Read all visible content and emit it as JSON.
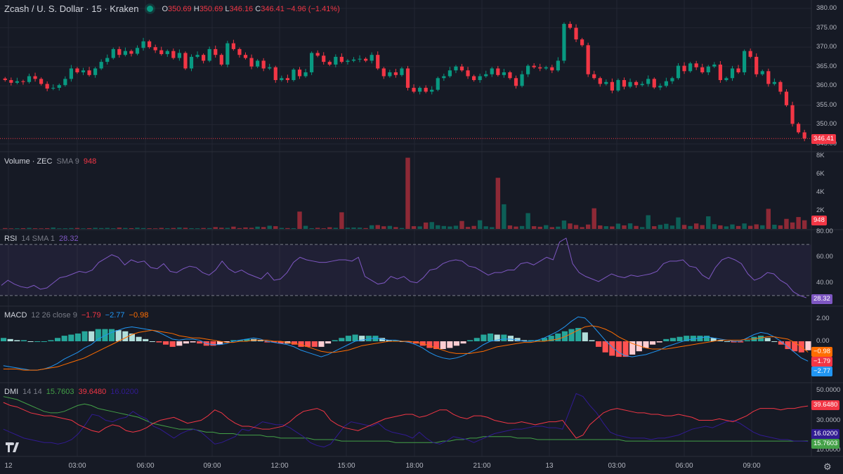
{
  "header": {
    "symbol": "Zcash / U. S. Dollar · 15 · Kraken",
    "open_label": "O",
    "open": "350.69",
    "high_label": "H",
    "high": "350.69",
    "low_label": "L",
    "low": "346.16",
    "close_label": "C",
    "close": "346.41",
    "change": "−4.96 (−1.41%)"
  },
  "volume_legend": {
    "title": "Volume · ZEC",
    "params": "SMA 9",
    "value": "948"
  },
  "rsi_legend": {
    "title": "RSI",
    "params": "14 SMA 1",
    "value": "28.32"
  },
  "macd_legend": {
    "title": "MACD",
    "params": "12 26 close 9",
    "v1": "−1.79",
    "v2": "−2.77",
    "v3": "−0.98"
  },
  "dmi_legend": {
    "title": "DMI",
    "params": "14 14",
    "v1": "15.7603",
    "v2": "39.6480",
    "v3": "16.0200"
  },
  "price_axis": [
    "380.00",
    "375.00",
    "370.00",
    "365.00",
    "360.00",
    "355.00",
    "350.00",
    "345.00"
  ],
  "volume_axis": [
    "8K",
    "6K",
    "4K",
    "2K"
  ],
  "rsi_axis": [
    "80.00",
    "60.00",
    "40.00"
  ],
  "macd_axis": [
    "2.00",
    "0.00"
  ],
  "dmi_axis": [
    "50.0000",
    "30.0000",
    "10.0000"
  ],
  "time_axis": [
    "12",
    "03:00",
    "06:00",
    "09:00",
    "12:00",
    "15:00",
    "18:00",
    "21:00",
    "13",
    "03:00",
    "06:00",
    "09:00"
  ],
  "badges": {
    "price": "346.41",
    "volume": "948",
    "rsi": "28.32",
    "macd_signal": "−0.98",
    "macd_line": "−1.79",
    "macd_hist": "−2.77",
    "dmi_adx": "39.6480",
    "dmi_plus": "16.0200",
    "dmi_minus": "15.7603"
  },
  "colors": {
    "up": "#089981",
    "down": "#f23645",
    "rsi": "#7e57c2",
    "macd": "#2962ff",
    "signal": "#ff6d00",
    "dmi_adx": "#f23645",
    "dmi_plus": "#43a047",
    "dmi_minus": "#311b92",
    "background": "#161a25"
  },
  "chart_data": [
    {
      "type": "candlestick",
      "title": "Zcash / U. S. Dollar · 15 · Kraken",
      "ylim": [
        345,
        380
      ],
      "close": [
        361.5,
        360.8,
        361.2,
        361.0,
        362.5,
        361.8,
        360.5,
        359.3,
        359.5,
        360.2,
        361.8,
        364.5,
        363.5,
        364.0,
        362.8,
        364.5,
        366.2,
        367.2,
        369.5,
        368.0,
        369.0,
        368.3,
        369.8,
        371.5,
        370.0,
        369.2,
        368.2,
        369.0,
        367.2,
        368.5,
        364.5,
        367.5,
        368.0,
        366.5,
        369.5,
        368.0,
        365.5,
        371.0,
        369.5,
        368.0,
        367.2,
        365.0,
        366.5,
        364.5,
        364.8,
        361.5,
        362.0,
        361.5,
        364.2,
        362.5,
        363.5,
        368.5,
        367.8,
        366.2,
        365.5,
        367.5,
        366.2,
        366.5,
        366.8,
        367.0,
        366.5,
        368.0,
        364.5,
        362.5,
        363.5,
        362.8,
        364.5,
        359.5,
        358.5,
        359.5,
        358.5,
        359.0,
        362.0,
        362.5,
        364.0,
        365.0,
        364.0,
        362.5,
        361.5,
        362.5,
        363.0,
        364.5,
        362.8,
        363.5,
        362.0,
        360.0,
        363.0,
        365.2,
        364.8,
        364.5,
        364.8,
        364.0,
        366.5,
        376.0,
        375.0,
        372.0,
        370.5,
        363.0,
        362.0,
        360.5,
        361.0,
        358.8,
        361.5,
        359.8,
        361.0,
        360.2,
        360.5,
        361.8,
        359.6,
        360.0,
        361.2,
        362.0,
        365.2,
        363.8,
        365.8,
        364.8,
        363.5,
        365.0,
        365.5,
        361.5,
        362.0,
        364.5,
        363.5,
        369.0,
        367.5,
        363.0,
        363.8,
        360.5,
        361.0,
        358.5,
        355.0,
        350.2,
        348.0,
        346.41
      ],
      "volume": [
        90,
        60,
        70,
        80,
        110,
        70,
        60,
        80,
        150,
        60,
        70,
        90,
        100,
        60,
        80,
        120,
        90,
        110,
        70,
        140,
        100,
        80,
        130,
        90,
        70,
        60,
        110,
        80,
        100,
        150,
        120,
        80,
        70,
        100,
        90,
        200,
        130,
        110,
        250,
        90,
        160,
        120,
        250,
        200,
        350,
        300,
        110,
        90,
        80,
        1900,
        340,
        80,
        120,
        70,
        180,
        120,
        1820,
        130,
        150,
        140,
        90,
        400,
        420,
        290,
        330,
        200,
        100,
        7800,
        300,
        280,
        700,
        750,
        400,
        320,
        270,
        350,
        870,
        220,
        330,
        950,
        290,
        190,
        5600,
        2700,
        380,
        260,
        320,
        1730,
        300,
        240,
        410,
        190,
        250,
        920,
        600,
        430,
        200,
        480,
        2260,
        380,
        300,
        270,
        580,
        390,
        610,
        330,
        200,
        1500,
        300,
        450,
        560,
        370,
        1260,
        440,
        320,
        600,
        420,
        1380,
        520,
        390,
        280,
        490,
        320,
        600,
        340,
        500,
        400,
        2200,
        460,
        390,
        1100,
        710,
        1300,
        948
      ],
      "volume_unit": "contracts",
      "volume_ylim": [
        0,
        8000
      ]
    },
    {
      "type": "line",
      "title": "RSI 14 SMA 1",
      "ylim": [
        25,
        80
      ],
      "series": [
        {
          "name": "RSI",
          "values": [
            38,
            42,
            39,
            37,
            36,
            38,
            35,
            36,
            40,
            44,
            45,
            47,
            49,
            48,
            50,
            56,
            59,
            62,
            60,
            54,
            58,
            56,
            57,
            52,
            51,
            55,
            49,
            48,
            51,
            53,
            52,
            48,
            46,
            50,
            57,
            51,
            48,
            50,
            47,
            45,
            43,
            48,
            42,
            43,
            48,
            56,
            60,
            58,
            57,
            56,
            56,
            57,
            58,
            58,
            57,
            60,
            45,
            42,
            39,
            40,
            45,
            43,
            45,
            41,
            40,
            44,
            50,
            51,
            55,
            57,
            58,
            57,
            53,
            52,
            49,
            46,
            48,
            48,
            50,
            50,
            55,
            56,
            54,
            57,
            60,
            58,
            72,
            75,
            55,
            48,
            45,
            43,
            41,
            44,
            47,
            45,
            44,
            46,
            45,
            46,
            47,
            49,
            55,
            57,
            57,
            58,
            53,
            52,
            46,
            43,
            52,
            58,
            60,
            58,
            55,
            47,
            42,
            44,
            48,
            47,
            42,
            39,
            33,
            30,
            28.32
          ]
        }
      ]
    },
    {
      "type": "line",
      "title": "MACD 12 26 close 9",
      "ylim": [
        -3.5,
        2.5
      ],
      "series": [
        {
          "name": "MACD",
          "values": [
            -2.2,
            -2.3,
            -2.4,
            -2.5,
            -2.6,
            -2.6,
            -2.5,
            -2.3,
            -2.0,
            -1.6,
            -1.3,
            -1.0,
            -0.6,
            -0.3,
            0.2,
            0.5,
            0.8,
            1.0,
            1.2,
            1.3,
            1.2,
            1.1,
            1.0,
            0.8,
            0.5,
            0.2,
            0.1,
            0.2,
            0.2,
            0.1,
            -0.2,
            -0.3,
            -0.3,
            -0.2,
            0.0,
            0.1,
            0.2,
            0.3,
            0.2,
            0.0,
            -0.1,
            -0.2,
            -0.3,
            -0.5,
            -0.8,
            -1.0,
            -1.2,
            -1.4,
            -1.2,
            -0.9,
            -0.6,
            -0.3,
            0.0,
            0.1,
            0.2,
            0.3,
            0.2,
            0.1,
            0.1,
            0.0,
            -0.1,
            -0.3,
            -0.6,
            -1.0,
            -1.3,
            -1.5,
            -1.6,
            -1.5,
            -1.3,
            -1.0,
            -0.7,
            -0.3,
            0.0,
            0.1,
            0.2,
            0.2,
            0.1,
            0.0,
            0.0,
            0.1,
            0.3,
            0.6,
            0.9,
            1.3,
            1.8,
            2.2,
            2.1,
            1.5,
            0.8,
            0.1,
            -0.5,
            -1.0,
            -1.3,
            -1.4,
            -1.3,
            -1.2,
            -1.0,
            -0.8,
            -0.5,
            -0.3,
            -0.1,
            0.1,
            0.2,
            0.3,
            0.4,
            0.3,
            0.2,
            0.1,
            0.0,
            0.0,
            0.3,
            0.6,
            0.8,
            0.7,
            0.4,
            0.0,
            -0.5,
            -1.0,
            -1.5,
            -1.79
          ]
        },
        {
          "name": "Signal",
          "values": [
            -2.5,
            -2.5,
            -2.5,
            -2.6,
            -2.6,
            -2.6,
            -2.5,
            -2.4,
            -2.3,
            -2.1,
            -1.9,
            -1.7,
            -1.5,
            -1.2,
            -0.9,
            -0.6,
            -0.3,
            0.0,
            0.3,
            0.6,
            0.8,
            0.9,
            1.0,
            0.9,
            0.8,
            0.7,
            0.5,
            0.4,
            0.3,
            0.3,
            0.2,
            0.1,
            0.0,
            -0.1,
            -0.1,
            0.0,
            0.0,
            0.1,
            0.1,
            0.1,
            0.0,
            0.0,
            -0.1,
            -0.2,
            -0.3,
            -0.5,
            -0.7,
            -0.9,
            -1.0,
            -1.0,
            -0.9,
            -0.8,
            -0.6,
            -0.4,
            -0.3,
            -0.2,
            -0.1,
            0.0,
            0.0,
            0.0,
            0.0,
            -0.1,
            -0.2,
            -0.4,
            -0.6,
            -0.8,
            -1.0,
            -1.1,
            -1.1,
            -1.1,
            -1.0,
            -0.9,
            -0.7,
            -0.5,
            -0.4,
            -0.3,
            -0.2,
            -0.1,
            -0.1,
            0.0,
            0.0,
            0.1,
            0.2,
            0.4,
            0.7,
            1.0,
            1.3,
            1.4,
            1.3,
            1.1,
            0.8,
            0.4,
            0.1,
            -0.2,
            -0.4,
            -0.6,
            -0.7,
            -0.7,
            -0.7,
            -0.6,
            -0.5,
            -0.4,
            -0.3,
            -0.2,
            -0.1,
            0.0,
            0.1,
            0.1,
            0.1,
            0.1,
            0.2,
            0.2,
            0.3,
            0.4,
            0.4,
            0.3,
            0.2,
            -0.1,
            -0.5,
            -0.98
          ]
        }
      ]
    },
    {
      "type": "line",
      "title": "DMI 14 14",
      "ylim": [
        8,
        52
      ],
      "series": [
        {
          "name": "ADX",
          "values": [
            46,
            45,
            44,
            42,
            40,
            38,
            36,
            35,
            35,
            36,
            38,
            40,
            41,
            40,
            38,
            37,
            36,
            35,
            34,
            33,
            32,
            30,
            28,
            27,
            26,
            25,
            24,
            24,
            24,
            23,
            22,
            22,
            21,
            21,
            21,
            20,
            20,
            20,
            20,
            19,
            19,
            18,
            18,
            18,
            18,
            18,
            17,
            17,
            17,
            17,
            16,
            16,
            16,
            16,
            16,
            16,
            16,
            16,
            15,
            15,
            15,
            15,
            15,
            15,
            15,
            16,
            16,
            17,
            17,
            18,
            18,
            19,
            19,
            19,
            19,
            19,
            18,
            18,
            18,
            17,
            17,
            17,
            17,
            17,
            17,
            17,
            17,
            17,
            17,
            17,
            17,
            17,
            16,
            16,
            16,
            16,
            16,
            16,
            16,
            16,
            16,
            16,
            16,
            16,
            16,
            16,
            16,
            16,
            16,
            16,
            16,
            16,
            16,
            16,
            16,
            16,
            16,
            16,
            16,
            16.02
          ]
        },
        {
          "name": "+DI",
          "values": [
            24,
            22,
            20,
            18,
            17,
            16,
            15,
            15,
            14,
            15,
            17,
            21,
            27,
            34,
            33,
            30,
            29,
            31,
            32,
            36,
            33,
            31,
            26,
            24,
            21,
            18,
            21,
            23,
            24,
            22,
            18,
            14,
            15,
            17,
            19,
            24,
            23,
            26,
            29,
            28,
            27,
            27,
            25,
            22,
            19,
            15,
            13,
            12,
            14,
            20,
            26,
            29,
            28,
            27,
            26,
            28,
            24,
            22,
            21,
            20,
            18,
            22,
            18,
            15,
            14,
            16,
            19,
            18,
            17,
            15,
            17,
            19,
            21,
            22,
            23,
            24,
            24,
            25,
            26,
            26,
            25,
            25,
            24,
            36,
            48,
            46,
            40,
            35,
            28,
            22,
            20,
            19,
            18,
            18,
            18,
            17,
            18,
            18,
            19,
            20,
            22,
            24,
            25,
            26,
            25,
            27,
            29,
            30,
            28,
            25,
            22,
            20,
            19,
            18,
            17,
            17,
            16,
            16,
            15.76
          ]
        },
        {
          "name": "−DI",
          "values": [
            42,
            40,
            39,
            37,
            35,
            34,
            33,
            33,
            32,
            31,
            30,
            27,
            25,
            23,
            22,
            25,
            27,
            26,
            23,
            22,
            23,
            25,
            28,
            30,
            31,
            32,
            30,
            28,
            29,
            30,
            33,
            37,
            35,
            31,
            28,
            26,
            26,
            25,
            24,
            24,
            25,
            26,
            29,
            33,
            36,
            37,
            38,
            36,
            30,
            27,
            25,
            24,
            23,
            25,
            27,
            29,
            31,
            32,
            33,
            34,
            34,
            32,
            33,
            35,
            37,
            37,
            34,
            32,
            31,
            33,
            33,
            32,
            30,
            29,
            28,
            28,
            29,
            28,
            27,
            28,
            29,
            29,
            30,
            24,
            18,
            20,
            27,
            31,
            35,
            37,
            38,
            37,
            36,
            35,
            35,
            34,
            34,
            33,
            33,
            34,
            33,
            32,
            30,
            30,
            30,
            31,
            30,
            29,
            31,
            33,
            36,
            38,
            38,
            38,
            37,
            38,
            38,
            39,
            39.648
          ]
        }
      ]
    }
  ]
}
